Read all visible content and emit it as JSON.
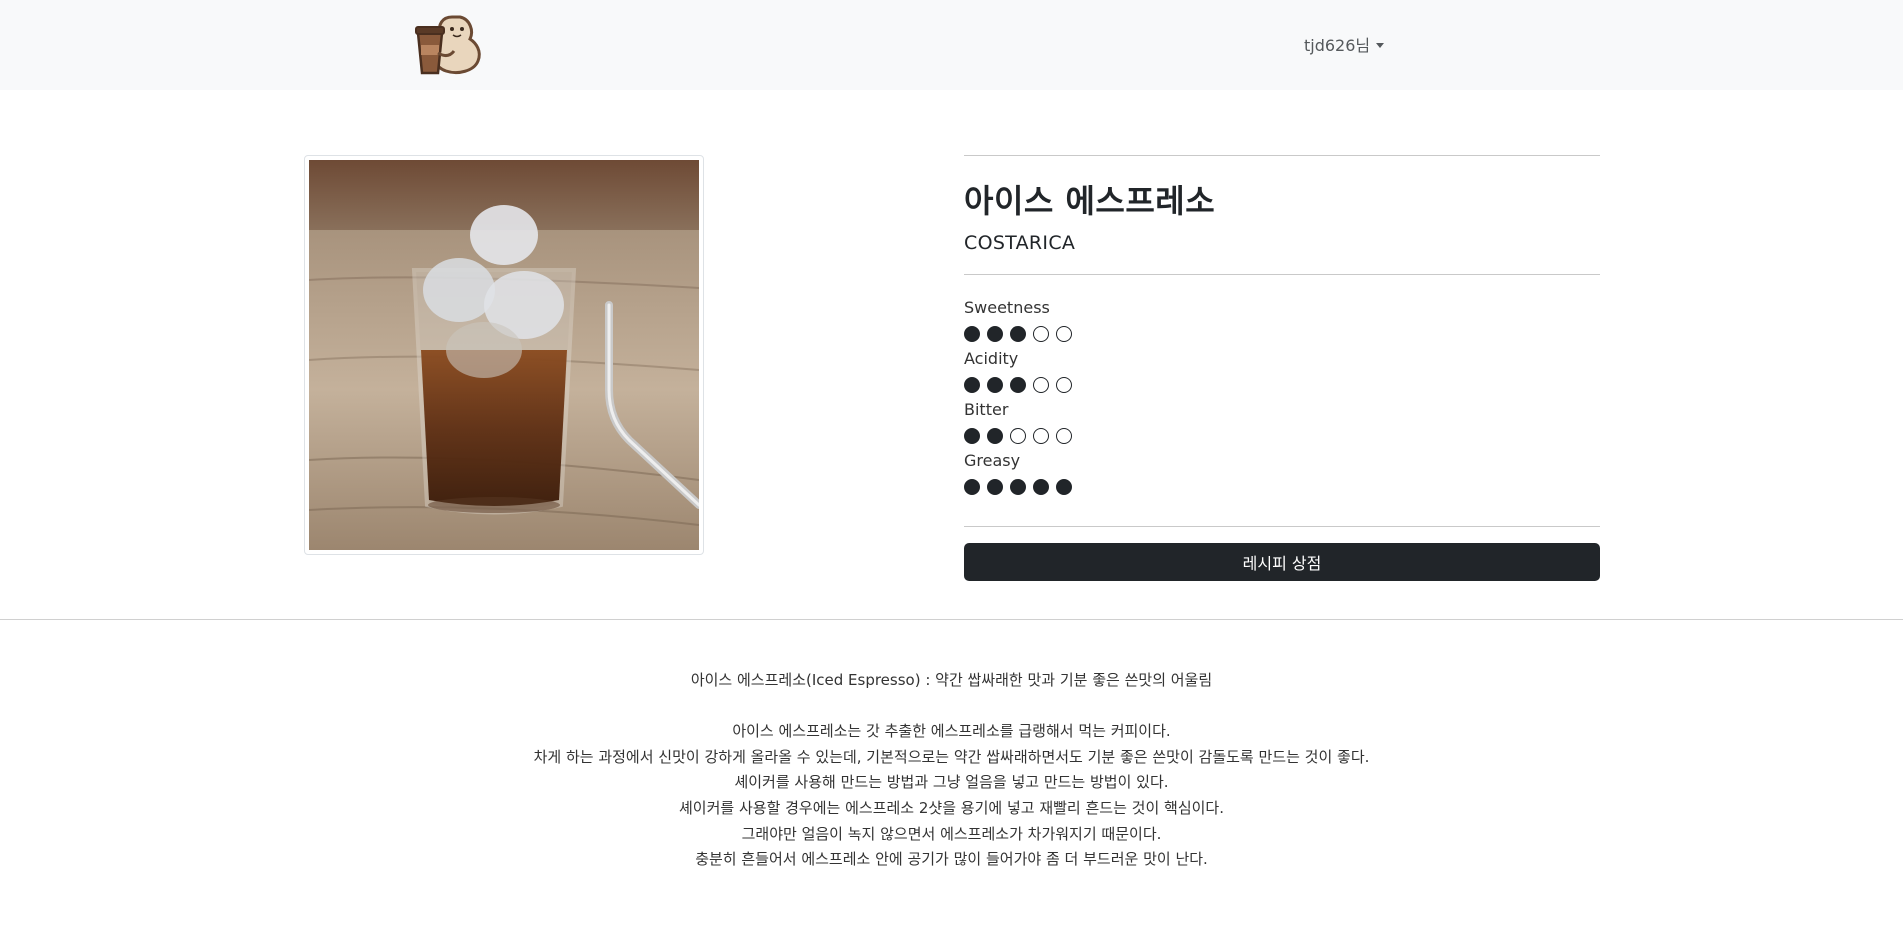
{
  "header": {
    "username": "tjd626님"
  },
  "product": {
    "name": "아이스 에스프레소",
    "origin": "COSTARICA",
    "tastes": [
      {
        "label": "Sweetness",
        "level": 3,
        "max": 5
      },
      {
        "label": "Acidity",
        "level": 3,
        "max": 5
      },
      {
        "label": "Bitter",
        "level": 2,
        "max": 5
      },
      {
        "label": "Greasy",
        "level": 5,
        "max": 5
      }
    ],
    "recipe_button_label": "레시피 상점"
  },
  "description": {
    "headline": "아이스 에스프레소(Iced Espresso) : 약간 쌉싸래한 맛과 기분 좋은 쓴맛의 어울림",
    "lines": [
      "아이스 에스프레소는 갓 추출한 에스프레소를 급랭해서 먹는 커피이다.",
      "차게 하는 과정에서 신맛이 강하게 올라올 수 있는데, 기본적으로는 약간 쌉싸래하면서도 기분 좋은 쓴맛이 감돌도록 만드는 것이 좋다.",
      "셰이커를 사용해 만드는 방법과 그냥 얼음을 넣고 만드는 방법이 있다.",
      "셰이커를 사용할 경우에는 에스프레소 2샷을 용기에 넣고 재빨리 흔드는 것이 핵심이다.",
      "그래야만 얼음이 녹지 않으면서 에스프레소가 차가워지기 때문이다.",
      "충분히 흔들어서 에스프레소 안에 공기가 많이 들어가야 좀 더 부드러운 맛이 난다."
    ]
  },
  "colors": {
    "navbar_bg": "#f8f9fa",
    "primary_dark": "#212529"
  }
}
